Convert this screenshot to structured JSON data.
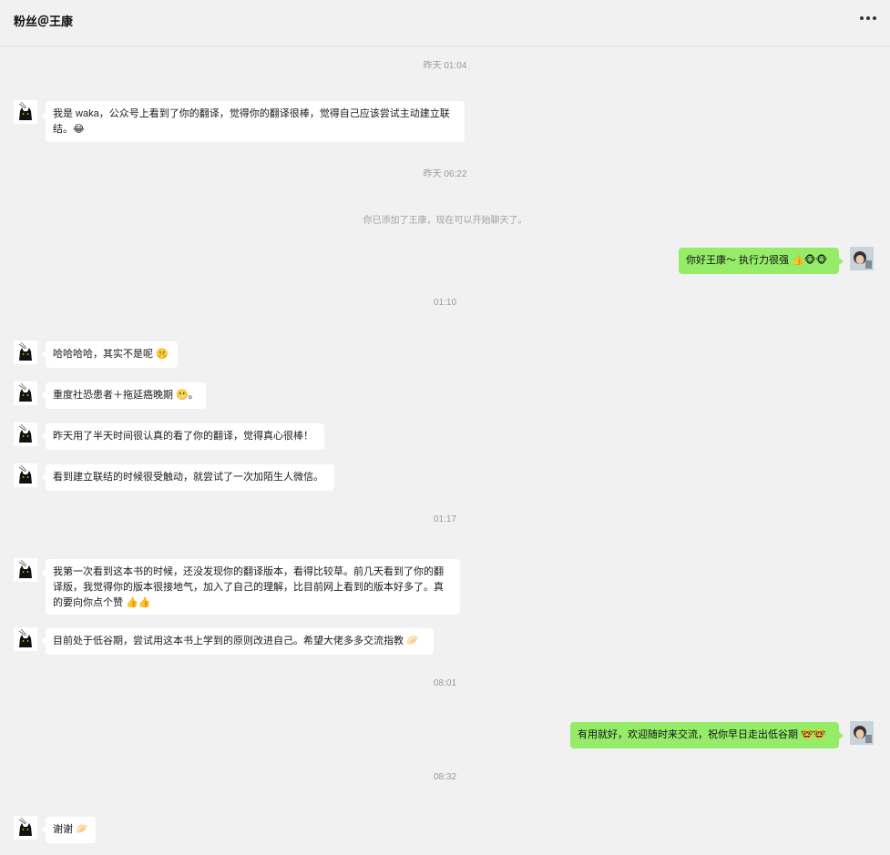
{
  "header": {
    "title": "粉丝＠王康",
    "more_icon": "more-horizontal-icon"
  },
  "timestamps": {
    "t1": "昨天 01:04",
    "t2": "昨天 06:22",
    "t3": "01:10",
    "t4": "01:17",
    "t5": "08:01",
    "t6": "08:32"
  },
  "system": {
    "added_friend": "你已添加了王康，现在可以开始聊天了。"
  },
  "messages": [
    {
      "from": "contact",
      "text": "我是 waka，公众号上看到了你的翻译，觉得你的翻译很棒，觉得自己应该尝试主动建立联结。😂"
    },
    {
      "from": "me",
      "text": "你好王康～ 执行力很强 👍🐵🐵"
    },
    {
      "from": "contact",
      "text": "哈哈哈哈，其实不是呢 🤫"
    },
    {
      "from": "contact",
      "text": "重度社恐患者＋拖延癌晚期 😬。"
    },
    {
      "from": "contact",
      "text": "昨天用了半天时间很认真的看了你的翻译，觉得真心很棒！"
    },
    {
      "from": "contact",
      "text": "看到建立联结的时候很受触动，就尝试了一次加陌生人微信。"
    },
    {
      "from": "contact",
      "text": "我第一次看到这本书的时候，还没发现你的翻译版本，看得比较草。前几天看到了你的翻译版，我觉得你的版本很接地气，加入了自己的理解，比目前网上看到的版本好多了。真的要向你点个赞 👍👍"
    },
    {
      "from": "contact",
      "text": "目前处于低谷期，尝试用这本书上学到的原则改进自己。希望大佬多多交流指教 🥟"
    },
    {
      "from": "me",
      "text": "有用就好，欢迎随时来交流，祝你早日走出低谷期 🤓🤓"
    },
    {
      "from": "contact",
      "text": "谢谢 🥟"
    }
  ],
  "colors": {
    "background": "#f1f1f1",
    "incoming_bubble": "#ffffff",
    "outgoing_bubble": "#95ec69"
  }
}
